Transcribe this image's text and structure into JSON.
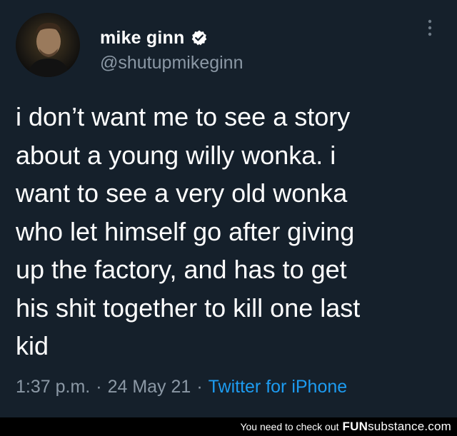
{
  "tweet": {
    "author": {
      "display_name": "mike ginn",
      "handle": "@shutupmikeginn",
      "verified": true
    },
    "text": "i don’t want me to see a story\nabout a young willy wonka. i\nwant to see a very old wonka\nwho let himself go after giving\nup the factory, and has to get\nhis shit together to kill one last\nkid",
    "time": "1:37 p.m.",
    "separator": "·",
    "date": "24 May 21",
    "source": "Twitter for iPhone"
  },
  "watermark": {
    "text": "You need to check out",
    "brand_part1": "FUN",
    "brand_part2": "substance.com"
  },
  "colors": {
    "background": "#15202b",
    "primary_text": "#ffffff",
    "secondary_text": "#8b98a5",
    "link": "#1d9bf0",
    "footer_bg": "#000000"
  },
  "icons": {
    "verified": "verified-badge-icon",
    "more": "more-options-icon"
  }
}
